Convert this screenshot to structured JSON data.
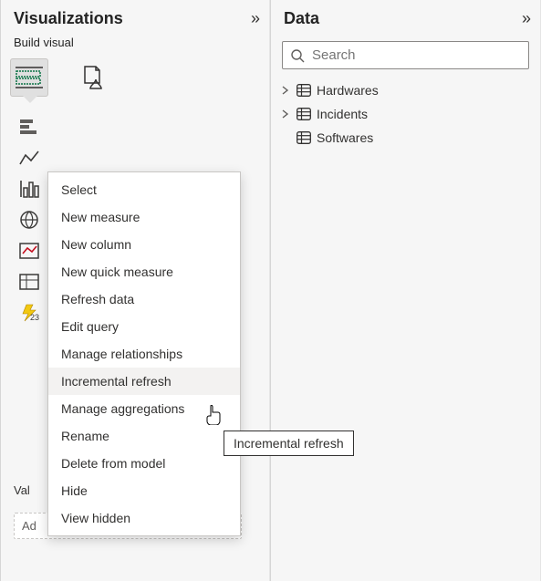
{
  "viz_pane": {
    "title": "Visualizations",
    "sub_label": "Build visual",
    "values_label": "Val",
    "add_placeholder": "Ad"
  },
  "data_pane": {
    "title": "Data",
    "search_placeholder": "Search",
    "items": [
      {
        "label": "Hardwares"
      },
      {
        "label": "Incidents"
      },
      {
        "label": "Softwares"
      }
    ]
  },
  "context_menu": {
    "items": [
      {
        "label": "Select"
      },
      {
        "label": "New measure"
      },
      {
        "label": "New column"
      },
      {
        "label": "New quick measure"
      },
      {
        "label": "Refresh data"
      },
      {
        "label": "Edit query"
      },
      {
        "label": "Manage relationships"
      },
      {
        "label": "Incremental refresh"
      },
      {
        "label": "Manage aggregations"
      },
      {
        "label": "Rename"
      },
      {
        "label": "Delete from model"
      },
      {
        "label": "Hide"
      },
      {
        "label": "View hidden"
      }
    ],
    "tooltip": "Incremental refresh"
  }
}
